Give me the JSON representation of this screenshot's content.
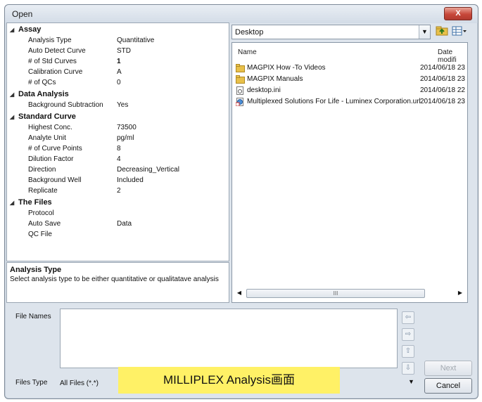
{
  "window": {
    "title": "Open",
    "close_glyph": "X"
  },
  "properties": [
    {
      "category": "Assay",
      "items": [
        {
          "label": "Analysis Type",
          "value": "Quantitative"
        },
        {
          "label": "Auto Detect Curve",
          "value": "STD"
        },
        {
          "label": "# of Std Curves",
          "value": "1"
        },
        {
          "label": "Calibration Curve",
          "value": "A"
        },
        {
          "label": "# of QCs",
          "value": "0"
        }
      ]
    },
    {
      "category": "Data Analysis",
      "items": [
        {
          "label": "Background Subtraction",
          "value": "Yes"
        }
      ]
    },
    {
      "category": "Standard Curve",
      "items": [
        {
          "label": "Highest Conc.",
          "value": "73500"
        },
        {
          "label": "Analyte Unit",
          "value": "pg/ml"
        },
        {
          "label": "# of Curve Points",
          "value": "8"
        },
        {
          "label": "Dilution Factor",
          "value": "4"
        },
        {
          "label": "Direction",
          "value": "Decreasing_Vertical"
        },
        {
          "label": "Background Well",
          "value": "Included"
        },
        {
          "label": "Replicate",
          "value": "2"
        }
      ]
    },
    {
      "category": "The Files",
      "items": [
        {
          "label": "Protocol",
          "value": ""
        },
        {
          "label": "Auto Save",
          "value": "Data"
        },
        {
          "label": "QC File",
          "value": ""
        }
      ]
    }
  ],
  "description": {
    "title": "Analysis Type",
    "text": "Select analysis type to be either quantitative or qualitatave analysis"
  },
  "location": {
    "value": "Desktop"
  },
  "file_list": {
    "columns": {
      "name": "Name",
      "date": "Date modifi"
    },
    "rows": [
      {
        "name": "MAGPIX How -To Videos",
        "date": "2014/06/18 23",
        "icon": "folder-icon"
      },
      {
        "name": "MAGPIX Manuals",
        "date": "2014/06/18 23",
        "icon": "folder-icon"
      },
      {
        "name": "desktop.ini",
        "date": "2014/06/18 22",
        "icon": "settings-file-icon"
      },
      {
        "name": "Multiplexed Solutions For Life - Luminex Corporation.url",
        "date": "2014/06/18 23",
        "icon": "url-shortcut-icon"
      }
    ],
    "scroll_thumb_text": "III"
  },
  "file_names": {
    "label": "File Names",
    "value": ""
  },
  "file_type": {
    "label": "Files Type",
    "value": "All Files (*.*)"
  },
  "buttons": {
    "next": "Next",
    "cancel": "Cancel"
  },
  "caption": "MILLIPLEX Analysis画面",
  "colors": {
    "caption_bg": "#fff166",
    "close_button": "#c7473a",
    "folder": "#e8c04a"
  }
}
